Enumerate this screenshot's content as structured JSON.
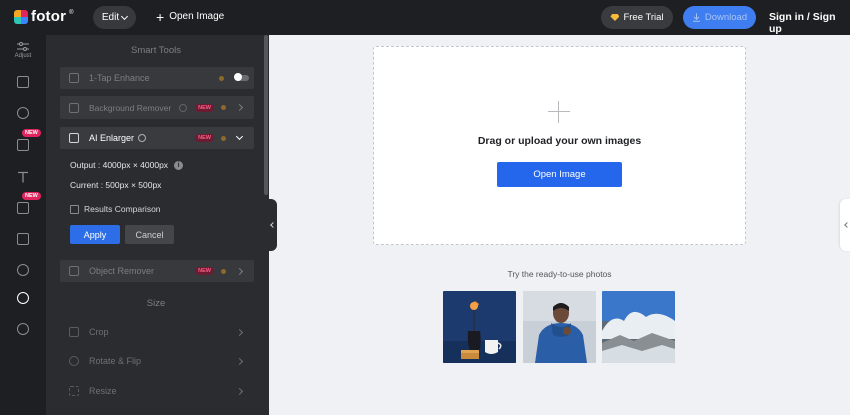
{
  "header": {
    "logo_text": "fotor",
    "logo_reg": "®",
    "edit_label": "Edit",
    "open_image_label": "Open Image",
    "free_trial_label": "Free Trial",
    "download_label": "Download",
    "signin_label": "Sign in / Sign up"
  },
  "rail": {
    "adjust_label": "Adjust",
    "badges": [
      "NEW",
      "NEW"
    ]
  },
  "panel": {
    "smart_tools_title": "Smart Tools",
    "size_title": "Size",
    "tools": {
      "one_tap": "1-Tap Enhance",
      "background": "Background Remover",
      "ai_enlarger": "AI Enlarger",
      "object_remover": "Object Remover"
    },
    "new_badge": "NEW",
    "output_text": "Output : 4000px × 4000px",
    "current_text": "Current : 500px × 500px",
    "results_comparison": "Results Comparison",
    "apply_label": "Apply",
    "cancel_label": "Cancel",
    "size_tools": {
      "crop": "Crop",
      "rotate": "Rotate & Flip",
      "resize": "Resize"
    }
  },
  "canvas": {
    "drop_text": "Drag or upload your own images",
    "open_image_button": "Open Image",
    "try_text": "Try the ready-to-use photos"
  },
  "colors": {
    "accent": "#2567ec",
    "topbar": "#1e1f22",
    "panel": "#2b2c30",
    "new_badge": "#e0245e"
  }
}
